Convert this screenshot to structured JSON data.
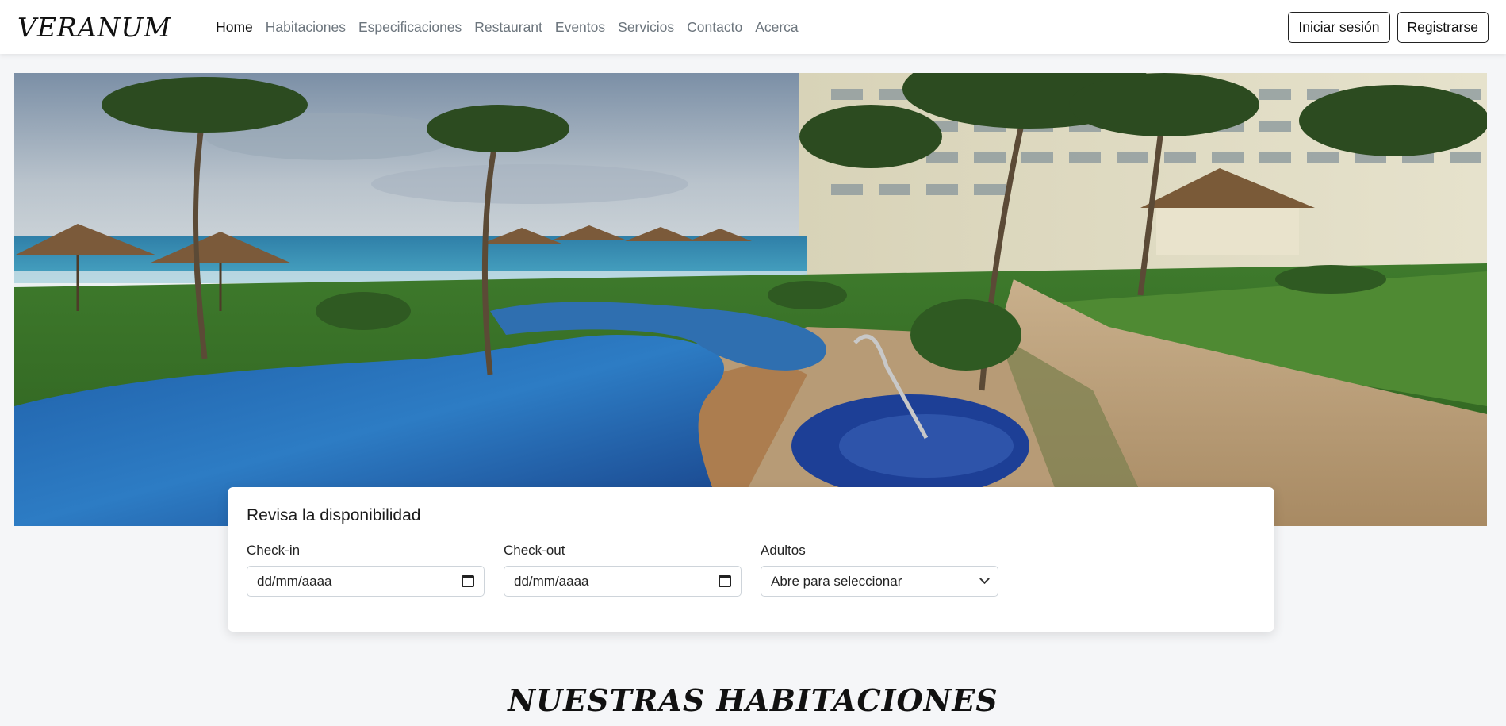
{
  "navbar": {
    "brand": "VERANUM",
    "links": [
      {
        "label": "Home",
        "active": true
      },
      {
        "label": "Habitaciones",
        "active": false
      },
      {
        "label": "Especificaciones",
        "active": false
      },
      {
        "label": "Restaurant",
        "active": false
      },
      {
        "label": "Eventos",
        "active": false
      },
      {
        "label": "Servicios",
        "active": false
      },
      {
        "label": "Contacto",
        "active": false
      },
      {
        "label": "Acerca",
        "active": false
      }
    ],
    "login_label": "Iniciar sesión",
    "register_label": "Registrarse"
  },
  "availability": {
    "title": "Revisa la disponibilidad",
    "checkin": {
      "label": "Check-in",
      "value": "dd/mm/aaaa"
    },
    "checkout": {
      "label": "Check-out",
      "value": "dd/mm/aaaa"
    },
    "adults": {
      "label": "Adultos",
      "value": "Abre para seleccionar"
    }
  },
  "rooms_section": {
    "heading": "NUESTRAS HABITACIONES"
  },
  "colors": {
    "page_bg": "#f5f6f8",
    "navbar_bg": "#ffffff",
    "active_link": "#111111",
    "inactive_link": "#6c757d"
  },
  "icons": {
    "date_picker": "calendar-icon",
    "select": "chevron-down-icon"
  }
}
